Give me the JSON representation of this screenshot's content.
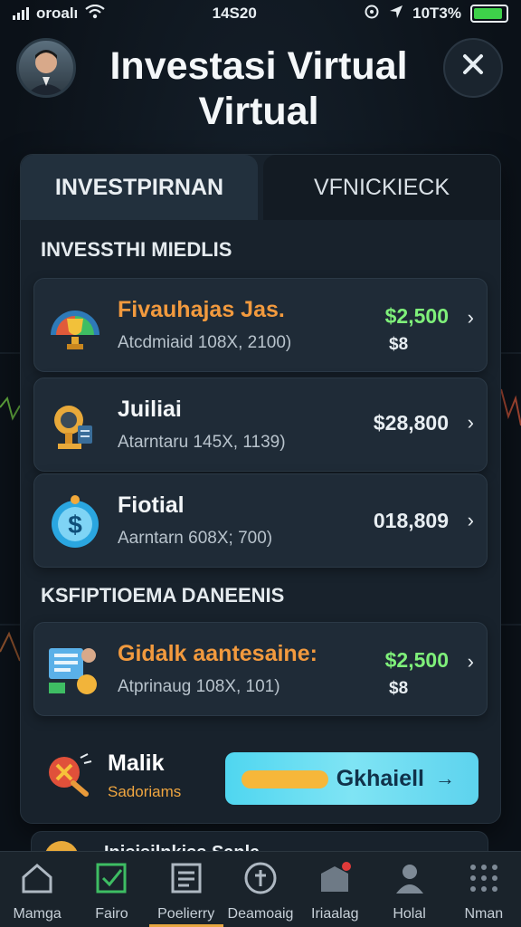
{
  "status_bar": {
    "carrier": "oroalı",
    "time": "14S20",
    "battery_text": "10T3%",
    "battery_level": 0.9
  },
  "header": {
    "title": "Investasi Virtual Virtual",
    "close_icon": "close-icon"
  },
  "tabs": [
    {
      "label": "INVESTPIRNAN",
      "active": true
    },
    {
      "label": "VFNICKIECK",
      "active": false
    }
  ],
  "sections": {
    "investments_title": "INVESSTHI MIEDLIS",
    "second_title": "KSFIPTIOEMA DANEENIS"
  },
  "investments": [
    {
      "name": "Fivauhajas Jas.",
      "sub": "Atcdmiaid 108X, 2100)",
      "value": "$2,500",
      "value2": "$8",
      "icon": "trophy-icon"
    },
    {
      "name": "Juiliai",
      "sub": "Atarntaru 145X, 1139)",
      "value": "$28,800",
      "icon": "lamp-icon"
    },
    {
      "name": "Fiotial",
      "sub": "Aarntarn 608X; 700)",
      "value": "018,809",
      "icon": "dollar-coin-icon"
    }
  ],
  "second_card": {
    "name": "Gidalk aantesaine:",
    "sub": "Atprinaug 108X, 101)",
    "value": "$2,500",
    "value2": "$8",
    "icon": "documents-icon"
  },
  "bottom_row": {
    "label": "Malik",
    "sub": "Sadoriams",
    "button_label": "Gkhaiell",
    "button_arrow": "→"
  },
  "peek_text": "Inisisilnkiss Sanla",
  "nav": [
    {
      "label": "Mamga",
      "icon": "home-icon"
    },
    {
      "label": "Fairo",
      "icon": "checkbox-icon"
    },
    {
      "label": "Poelierry",
      "icon": "list-icon",
      "active": true
    },
    {
      "label": "Deamoaig",
      "icon": "plus-circle-icon"
    },
    {
      "label": "Iriaalag",
      "icon": "inbox-icon"
    },
    {
      "label": "Holal",
      "icon": "person-icon"
    },
    {
      "label": "Nman",
      "icon": "grid-icon"
    }
  ]
}
